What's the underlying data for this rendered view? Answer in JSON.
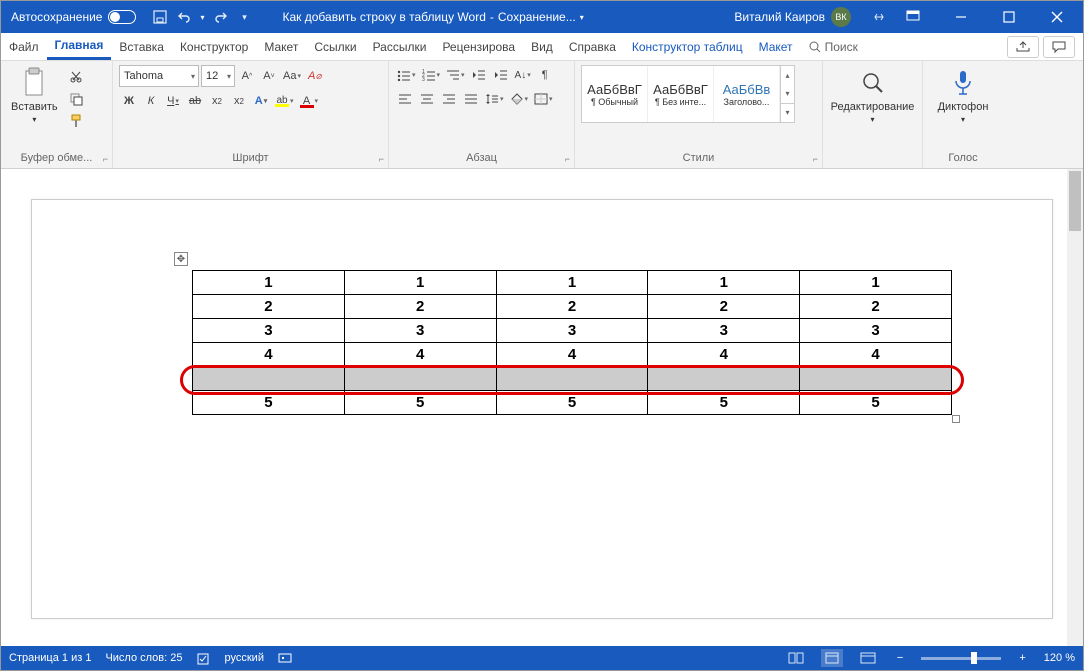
{
  "titlebar": {
    "autosave_label": "Автосохранение",
    "doc_name": "Как добавить строку в таблицу Word",
    "save_status": "Сохранение...",
    "user_name": "Виталий Каиров",
    "user_initials": "ВК"
  },
  "tabs": {
    "items": [
      "Файл",
      "Главная",
      "Вставка",
      "Конструктор",
      "Макет",
      "Ссылки",
      "Рассылки",
      "Рецензирова",
      "Вид",
      "Справка",
      "Конструктор таблиц",
      "Макет"
    ],
    "active_index": 1,
    "context_start": 10,
    "search_placeholder": "Поиск"
  },
  "ribbon": {
    "clipboard": {
      "paste": "Вставить",
      "label": "Буфер обме..."
    },
    "font": {
      "name": "Tahoma",
      "size": "12",
      "label": "Шрифт",
      "bold": "Ж",
      "italic": "К",
      "underline": "Ч",
      "strike": "ab",
      "sub": "x₂",
      "sup": "x²",
      "aa": "Aa",
      "clear": "Aₓ",
      "grow": "A^",
      "shrink": "A˅"
    },
    "paragraph": {
      "label": "Абзац"
    },
    "styles": {
      "label": "Стили",
      "items": [
        {
          "preview": "АаБбВвГ",
          "name": "¶ Обычный"
        },
        {
          "preview": "АаБбВвГ",
          "name": "¶ Без инте..."
        },
        {
          "preview": "АаБбВв",
          "name": "Заголово..."
        }
      ]
    },
    "editing": {
      "label": "Редактирование"
    },
    "voice": {
      "dictate": "Диктофон",
      "label": "Голос"
    }
  },
  "table": {
    "rows": [
      [
        "1",
        "1",
        "1",
        "1",
        "1"
      ],
      [
        "2",
        "2",
        "2",
        "2",
        "2"
      ],
      [
        "3",
        "3",
        "3",
        "3",
        "3"
      ],
      [
        "4",
        "4",
        "4",
        "4",
        "4"
      ],
      [
        "",
        "",
        "",
        "",
        ""
      ],
      [
        "5",
        "5",
        "5",
        "5",
        "5"
      ]
    ],
    "selected_row": 4
  },
  "statusbar": {
    "page": "Страница 1 из 1",
    "words": "Число слов: 25",
    "lang": "русский",
    "zoom": "120 %"
  }
}
